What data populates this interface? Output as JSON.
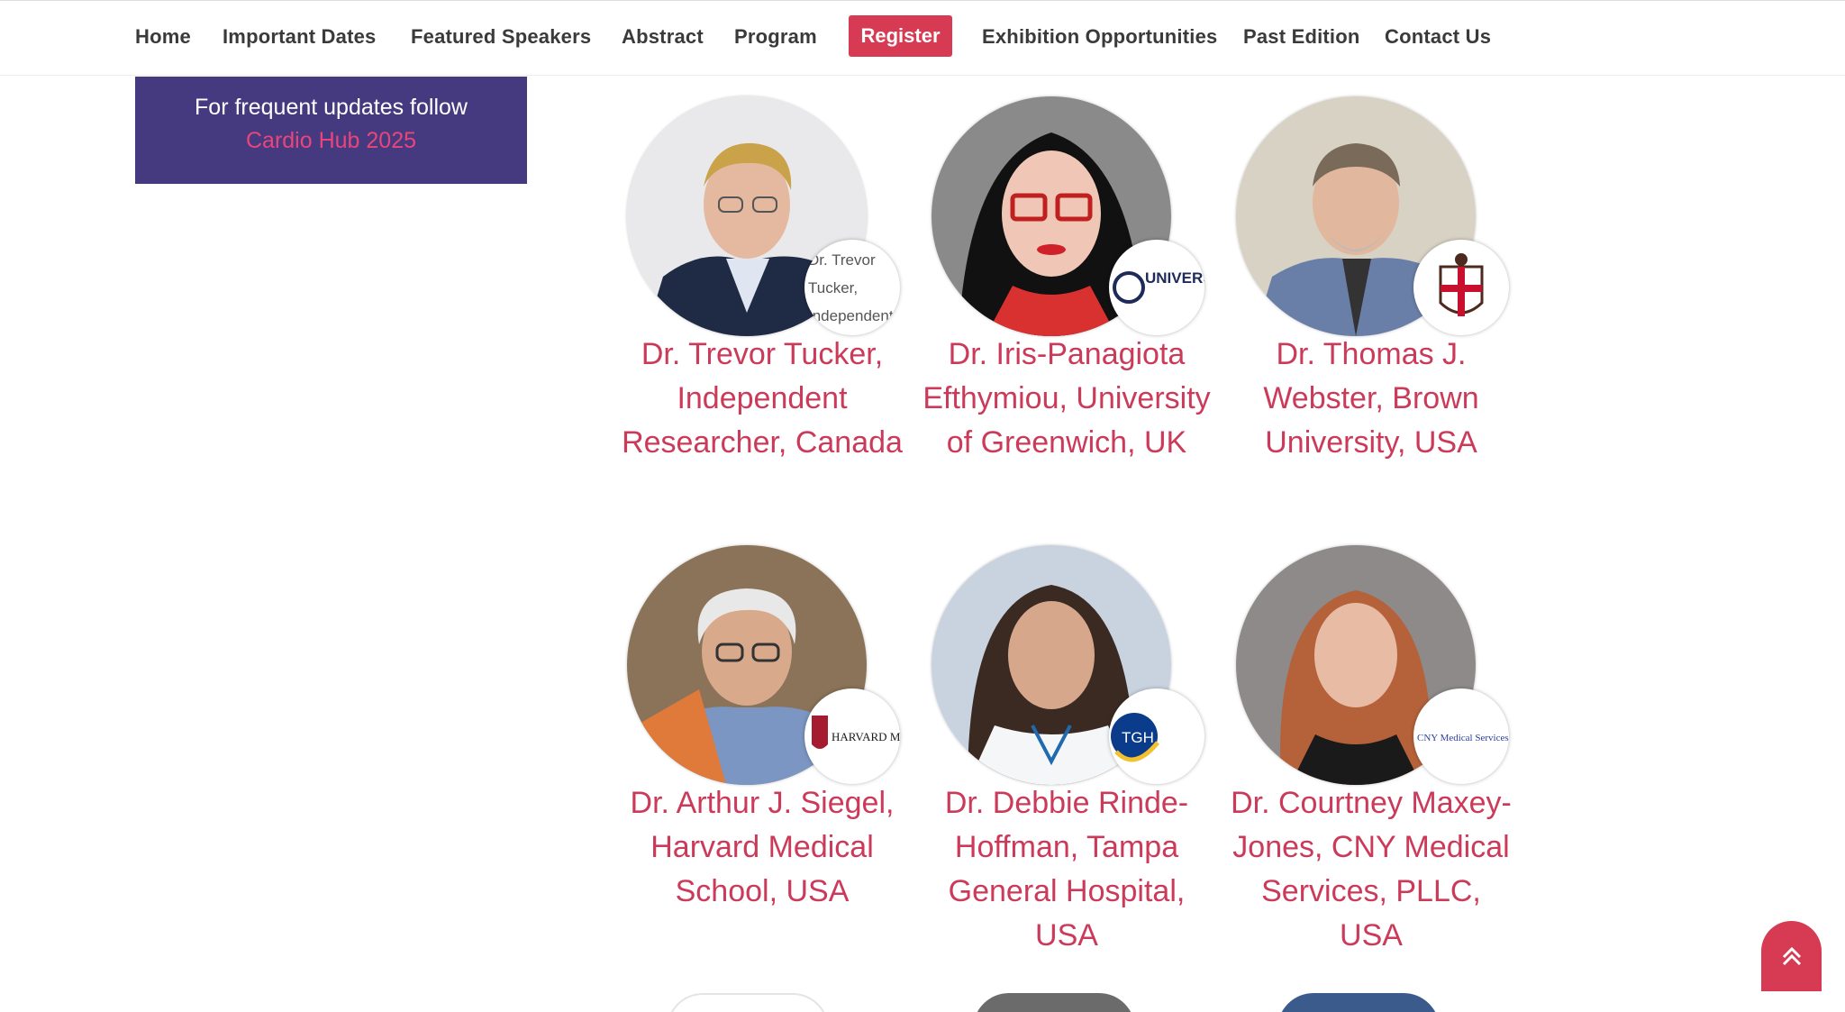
{
  "nav": {
    "items": [
      "Home",
      "Important Dates",
      "Featured Speakers",
      "Abstract",
      "Program"
    ],
    "register": "Register",
    "items_after": [
      "Exhibition Opportunities",
      "Past Edition",
      "Contact Us"
    ]
  },
  "follow": {
    "text": "For frequent updates follow",
    "link": "Cardio Hub 2025"
  },
  "speakers": [
    {
      "name": "Dr. Trevor Tucker, Independent Researcher, Canada",
      "logo_alt": "Dr. Trevor Tucker, Independent"
    },
    {
      "name": "Dr. Iris-Panagiota Efthymiou, University of Greenwich, UK",
      "logo_text": "UNIVERSITY OF GREENWICH"
    },
    {
      "name": "Dr. Thomas J. Webster, Brown University, USA",
      "logo_text": ""
    },
    {
      "name": "Dr. Arthur J. Siegel, Harvard Medical School, USA",
      "logo_text": "HARVARD MEDICAL SCHOOL"
    },
    {
      "name": "Dr. Debbie Rinde-Hoffman, Tampa General Hospital, USA",
      "logo_text": "TGH Tampa General Hospital"
    },
    {
      "name": "Dr. Courtney Maxey-Jones, CNY Medical Services, PLLC, USA",
      "logo_text": "CNY Medical Services, PLLC"
    }
  ],
  "colors": {
    "accent": "#d63b53",
    "name_text": "#cc3a5a",
    "follow_bg": "#453a7f",
    "follow_link": "#e9457a"
  },
  "icons": {
    "back_to_top": "double-chevron-up-icon"
  }
}
